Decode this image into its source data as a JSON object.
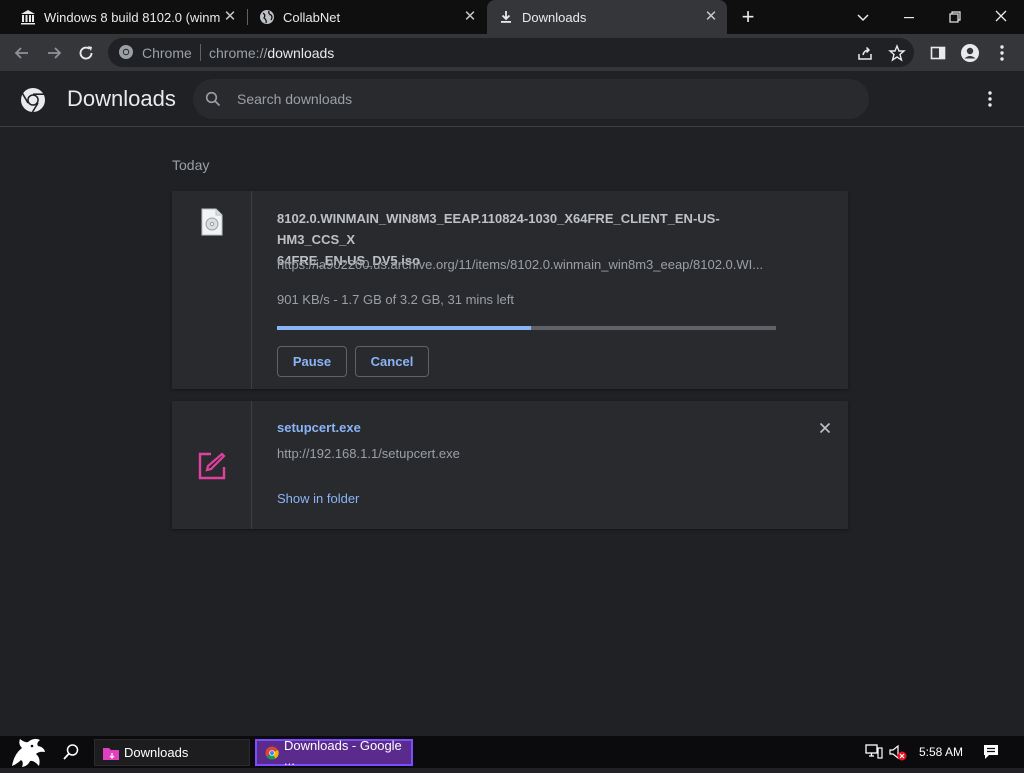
{
  "tabs": [
    {
      "title": "Windows 8 build 8102.0 (winmain",
      "icon": "bank-icon",
      "active": false
    },
    {
      "title": "CollabNet",
      "icon": "globe-icon",
      "active": false
    },
    {
      "title": "Downloads",
      "icon": "download-icon",
      "active": true
    }
  ],
  "toolbar": {
    "site_chip": "Chrome",
    "url_scheme": "chrome://",
    "url_host": "downloads"
  },
  "page": {
    "title": "Downloads",
    "search_placeholder": "Search downloads"
  },
  "section": {
    "label": "Today"
  },
  "downloads": [
    {
      "filename_line1": "8102.0.WINMAIN_WIN8M3_EEAP.110824-1030_X64FRE_CLIENT_EN-US-HM3_CCS_X",
      "filename_line2": "64FRE_EN-US_DV5.iso",
      "url": "https://ia902200.us.archive.org/11/items/8102.0.winmain_win8m3_eeap/8102.0.WI...",
      "status": "901 KB/s - 1.7 GB of 3.2 GB, 31 mins left",
      "progress": 0.51,
      "pause_label": "Pause",
      "cancel_label": "Cancel"
    },
    {
      "filename": "setupcert.exe",
      "url": "http://192.168.1.1/setupcert.exe",
      "show_in_folder": "Show in folder"
    }
  ],
  "taskbar": {
    "apps": [
      {
        "label": "Downloads",
        "active": false
      },
      {
        "label": "Downloads - Google ...",
        "active": true
      }
    ],
    "clock": "5:58 AM"
  },
  "colors": {
    "accent": "#8ab4f8",
    "background": "#202124",
    "card": "#292a2d",
    "taskbar_active": "#7c4dff",
    "file_icon_pink": "#e040a0"
  }
}
